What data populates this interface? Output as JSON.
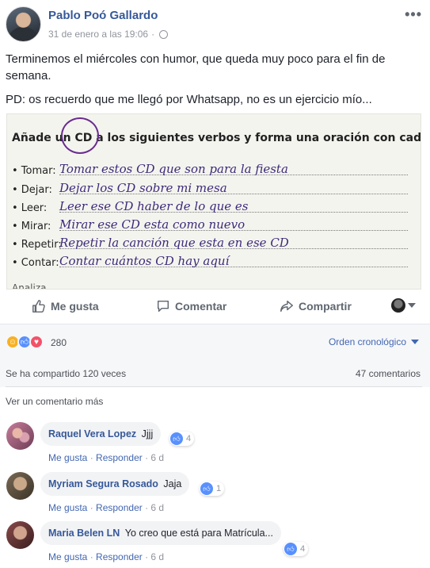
{
  "post": {
    "author": "Pablo Poó Gallardo",
    "date": "31 de enero a las 19:06",
    "dot": "·",
    "more": "•••",
    "text_1": "Terminemos el miércoles con humor, que queda muy poco para el fin de semana.",
    "text_2": "PD: os recuerdo que me llegó por Whatsapp, no es un ejercicio mío..."
  },
  "worksheet": {
    "title": "Añade un CD a los siguientes verbos y forma una oración con cada uno de ellos (",
    "rows": [
      {
        "verb": "• Tomar:",
        "answer": "Tomar estos CD que son para la fiesta"
      },
      {
        "verb": "• Dejar:",
        "answer": "Dejar los CD sobre mi mesa"
      },
      {
        "verb": "• Leer:",
        "answer": "Leer ese CD haber de lo que es"
      },
      {
        "verb": "• Mirar:",
        "answer": "Mirar ese CD esta como nuevo"
      },
      {
        "verb": "• Repetir:",
        "answer": "Repetir la canción que esta en ese CD"
      },
      {
        "verb": "• Contar:",
        "answer": "Contar cuántos CD hay aquí"
      }
    ],
    "cut_text": "Analiza..."
  },
  "actions": {
    "like": "Me gusta",
    "comment": "Comentar",
    "share": "Compartir"
  },
  "reactions": {
    "count": "280",
    "order": "Orden cronológico",
    "shared": "Se ha compartido 120 veces",
    "comments": "47 comentarios",
    "more_comments": "Ver un comentario más"
  },
  "comments": [
    {
      "name": "Raquel Vera Lopez",
      "text": "Jjjj",
      "likes": "4",
      "like_label": "Me gusta",
      "reply_label": "Responder",
      "age": "6 d"
    },
    {
      "name": "Myriam Segura Rosado",
      "text": "Jaja",
      "likes": "1",
      "like_label": "Me gusta",
      "reply_label": "Responder",
      "age": "6 d"
    },
    {
      "name": "Maria Belen LN",
      "text": "Yo creo que está para Matrícula...",
      "likes": "4",
      "like_label": "Me gusta",
      "reply_label": "Responder",
      "age": "6 d"
    }
  ],
  "colors": {
    "link": "#365899",
    "accent": "#4267b2",
    "muted": "#90949c"
  }
}
